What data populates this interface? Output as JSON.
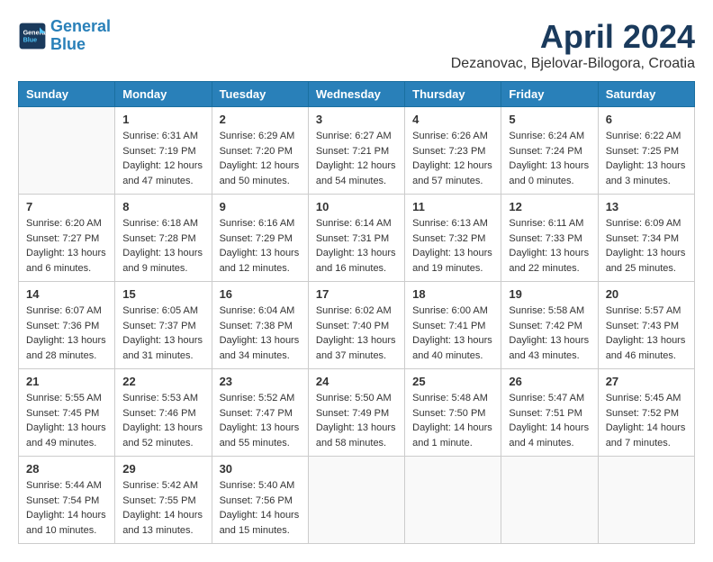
{
  "header": {
    "logo_line1": "General",
    "logo_line2": "Blue",
    "month_title": "April 2024",
    "location": "Dezanovac, Bjelovar-Bilogora, Croatia"
  },
  "days_of_week": [
    "Sunday",
    "Monday",
    "Tuesday",
    "Wednesday",
    "Thursday",
    "Friday",
    "Saturday"
  ],
  "weeks": [
    [
      {
        "day": "",
        "empty": true
      },
      {
        "day": "1",
        "sunrise": "Sunrise: 6:31 AM",
        "sunset": "Sunset: 7:19 PM",
        "daylight": "Daylight: 12 hours and 47 minutes."
      },
      {
        "day": "2",
        "sunrise": "Sunrise: 6:29 AM",
        "sunset": "Sunset: 7:20 PM",
        "daylight": "Daylight: 12 hours and 50 minutes."
      },
      {
        "day": "3",
        "sunrise": "Sunrise: 6:27 AM",
        "sunset": "Sunset: 7:21 PM",
        "daylight": "Daylight: 12 hours and 54 minutes."
      },
      {
        "day": "4",
        "sunrise": "Sunrise: 6:26 AM",
        "sunset": "Sunset: 7:23 PM",
        "daylight": "Daylight: 12 hours and 57 minutes."
      },
      {
        "day": "5",
        "sunrise": "Sunrise: 6:24 AM",
        "sunset": "Sunset: 7:24 PM",
        "daylight": "Daylight: 13 hours and 0 minutes."
      },
      {
        "day": "6",
        "sunrise": "Sunrise: 6:22 AM",
        "sunset": "Sunset: 7:25 PM",
        "daylight": "Daylight: 13 hours and 3 minutes."
      }
    ],
    [
      {
        "day": "7",
        "sunrise": "Sunrise: 6:20 AM",
        "sunset": "Sunset: 7:27 PM",
        "daylight": "Daylight: 13 hours and 6 minutes."
      },
      {
        "day": "8",
        "sunrise": "Sunrise: 6:18 AM",
        "sunset": "Sunset: 7:28 PM",
        "daylight": "Daylight: 13 hours and 9 minutes."
      },
      {
        "day": "9",
        "sunrise": "Sunrise: 6:16 AM",
        "sunset": "Sunset: 7:29 PM",
        "daylight": "Daylight: 13 hours and 12 minutes."
      },
      {
        "day": "10",
        "sunrise": "Sunrise: 6:14 AM",
        "sunset": "Sunset: 7:31 PM",
        "daylight": "Daylight: 13 hours and 16 minutes."
      },
      {
        "day": "11",
        "sunrise": "Sunrise: 6:13 AM",
        "sunset": "Sunset: 7:32 PM",
        "daylight": "Daylight: 13 hours and 19 minutes."
      },
      {
        "day": "12",
        "sunrise": "Sunrise: 6:11 AM",
        "sunset": "Sunset: 7:33 PM",
        "daylight": "Daylight: 13 hours and 22 minutes."
      },
      {
        "day": "13",
        "sunrise": "Sunrise: 6:09 AM",
        "sunset": "Sunset: 7:34 PM",
        "daylight": "Daylight: 13 hours and 25 minutes."
      }
    ],
    [
      {
        "day": "14",
        "sunrise": "Sunrise: 6:07 AM",
        "sunset": "Sunset: 7:36 PM",
        "daylight": "Daylight: 13 hours and 28 minutes."
      },
      {
        "day": "15",
        "sunrise": "Sunrise: 6:05 AM",
        "sunset": "Sunset: 7:37 PM",
        "daylight": "Daylight: 13 hours and 31 minutes."
      },
      {
        "day": "16",
        "sunrise": "Sunrise: 6:04 AM",
        "sunset": "Sunset: 7:38 PM",
        "daylight": "Daylight: 13 hours and 34 minutes."
      },
      {
        "day": "17",
        "sunrise": "Sunrise: 6:02 AM",
        "sunset": "Sunset: 7:40 PM",
        "daylight": "Daylight: 13 hours and 37 minutes."
      },
      {
        "day": "18",
        "sunrise": "Sunrise: 6:00 AM",
        "sunset": "Sunset: 7:41 PM",
        "daylight": "Daylight: 13 hours and 40 minutes."
      },
      {
        "day": "19",
        "sunrise": "Sunrise: 5:58 AM",
        "sunset": "Sunset: 7:42 PM",
        "daylight": "Daylight: 13 hours and 43 minutes."
      },
      {
        "day": "20",
        "sunrise": "Sunrise: 5:57 AM",
        "sunset": "Sunset: 7:43 PM",
        "daylight": "Daylight: 13 hours and 46 minutes."
      }
    ],
    [
      {
        "day": "21",
        "sunrise": "Sunrise: 5:55 AM",
        "sunset": "Sunset: 7:45 PM",
        "daylight": "Daylight: 13 hours and 49 minutes."
      },
      {
        "day": "22",
        "sunrise": "Sunrise: 5:53 AM",
        "sunset": "Sunset: 7:46 PM",
        "daylight": "Daylight: 13 hours and 52 minutes."
      },
      {
        "day": "23",
        "sunrise": "Sunrise: 5:52 AM",
        "sunset": "Sunset: 7:47 PM",
        "daylight": "Daylight: 13 hours and 55 minutes."
      },
      {
        "day": "24",
        "sunrise": "Sunrise: 5:50 AM",
        "sunset": "Sunset: 7:49 PM",
        "daylight": "Daylight: 13 hours and 58 minutes."
      },
      {
        "day": "25",
        "sunrise": "Sunrise: 5:48 AM",
        "sunset": "Sunset: 7:50 PM",
        "daylight": "Daylight: 14 hours and 1 minute."
      },
      {
        "day": "26",
        "sunrise": "Sunrise: 5:47 AM",
        "sunset": "Sunset: 7:51 PM",
        "daylight": "Daylight: 14 hours and 4 minutes."
      },
      {
        "day": "27",
        "sunrise": "Sunrise: 5:45 AM",
        "sunset": "Sunset: 7:52 PM",
        "daylight": "Daylight: 14 hours and 7 minutes."
      }
    ],
    [
      {
        "day": "28",
        "sunrise": "Sunrise: 5:44 AM",
        "sunset": "Sunset: 7:54 PM",
        "daylight": "Daylight: 14 hours and 10 minutes."
      },
      {
        "day": "29",
        "sunrise": "Sunrise: 5:42 AM",
        "sunset": "Sunset: 7:55 PM",
        "daylight": "Daylight: 14 hours and 13 minutes."
      },
      {
        "day": "30",
        "sunrise": "Sunrise: 5:40 AM",
        "sunset": "Sunset: 7:56 PM",
        "daylight": "Daylight: 14 hours and 15 minutes."
      },
      {
        "day": "",
        "empty": true
      },
      {
        "day": "",
        "empty": true
      },
      {
        "day": "",
        "empty": true
      },
      {
        "day": "",
        "empty": true
      }
    ]
  ]
}
